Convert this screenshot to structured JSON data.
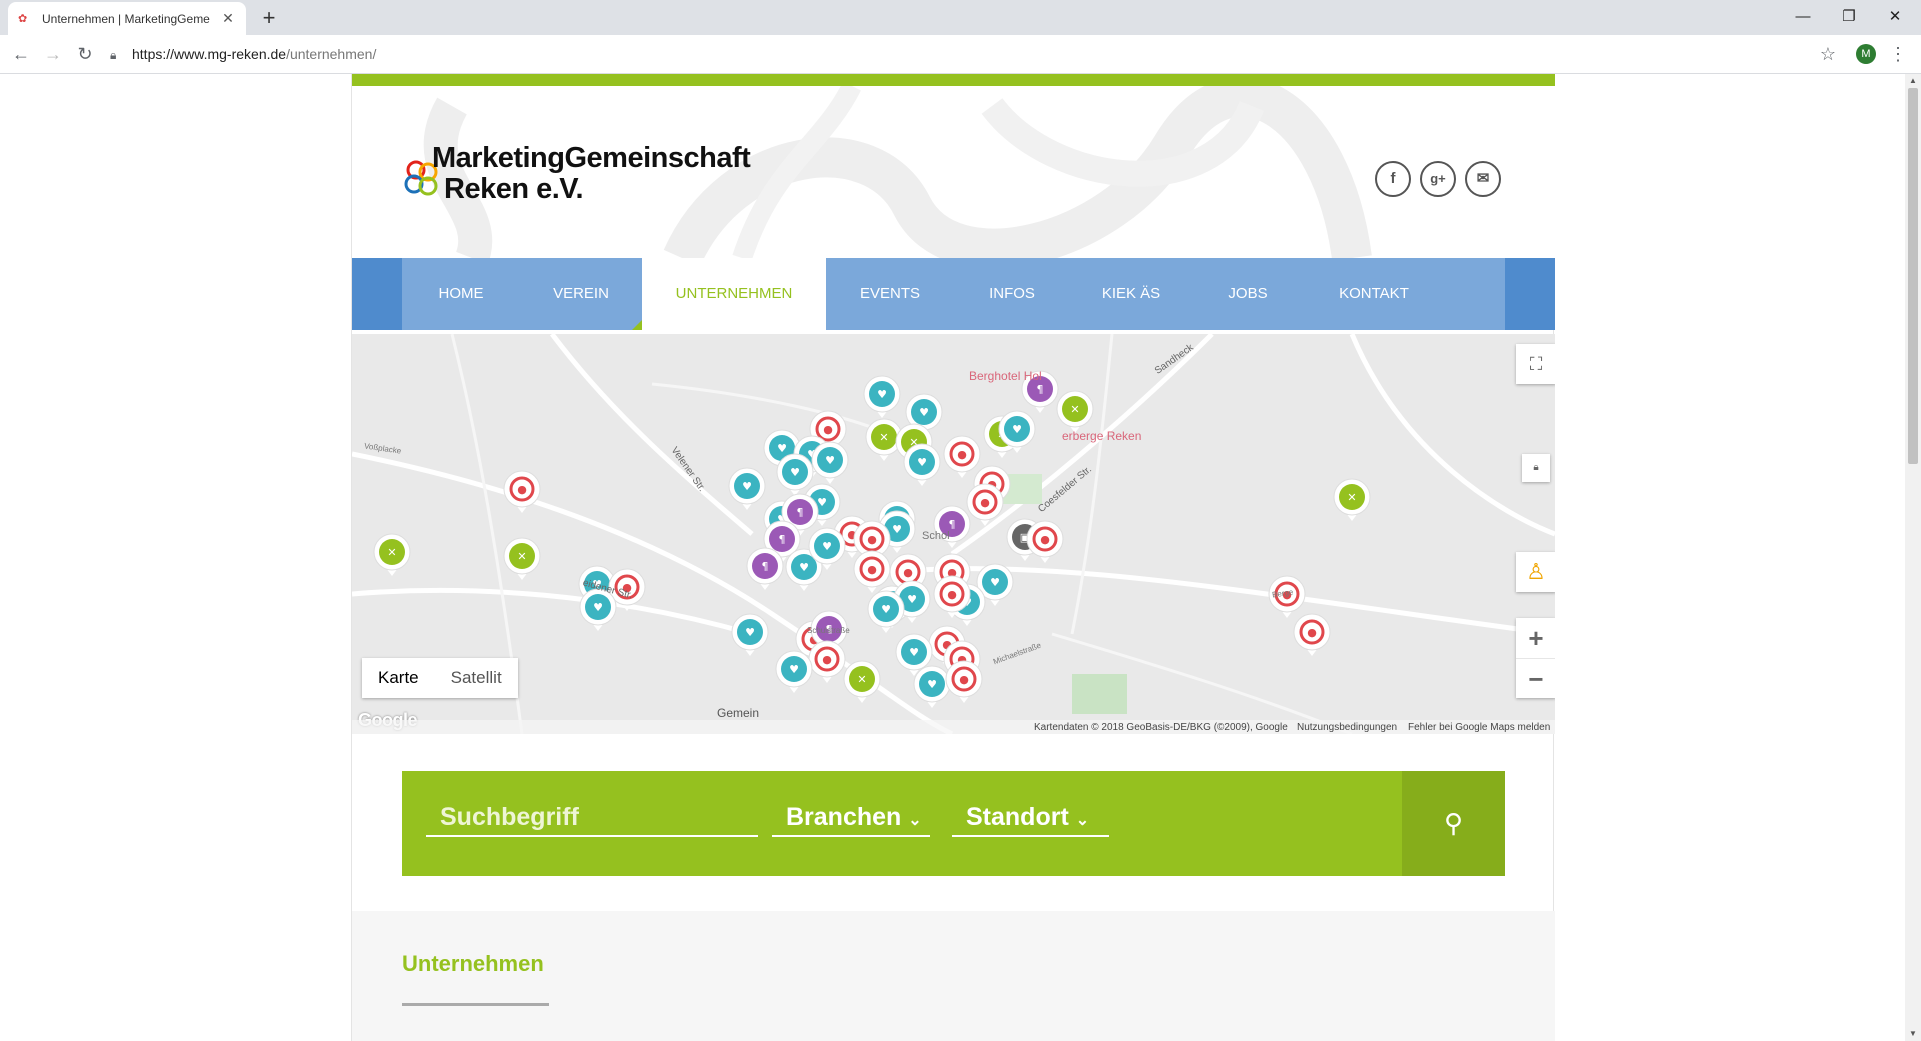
{
  "browser": {
    "tab_title": "Unternehmen | MarketingGeme",
    "tab_close": "✕",
    "new_tab": "+",
    "url_host": "https://www.mg-reken.de",
    "url_path": "/unternehmen/",
    "profile_initial": "M",
    "window_min": "—",
    "window_restore": "❐",
    "window_close": "✕"
  },
  "site": {
    "logo_line1": "MarketingGemeinschaft",
    "logo_line2": "Reken e.V.",
    "social": [
      "f",
      "g+",
      "✉"
    ],
    "nav": [
      "HOME",
      "VEREIN",
      "UNTERNEHMEN",
      "EVENTS",
      "INFOS",
      "KIEK ÄS",
      "JOBS",
      "KONTAKT"
    ],
    "active_nav": "UNTERNEHMEN",
    "accent_green": "#95c11f",
    "nav_blue": "#7ba8da"
  },
  "map": {
    "type_map": "Karte",
    "type_sat": "Satellit",
    "poi_hotel": "Berghotel Hol",
    "poi_herberge": "erberge Reken",
    "streets": [
      "Velener Str.",
      "Coesfelder Str.",
      "Sandheck",
      "Voßplacke",
      "Berge",
      "Schulstraße",
      "Michaelstraße",
      "Gemein",
      "Schol",
      "eidener Str."
    ],
    "attribution": "Kartendaten © 2018 GeoBasis-DE/BKG (©2009), Google",
    "terms": "Nutzungsbedingungen",
    "report": "Fehler bei Google Maps melden",
    "google": "Google",
    "zoom_in": "+",
    "zoom_out": "−"
  },
  "search": {
    "placeholder": "Suchbegriff",
    "branchen": "Branchen",
    "standort": "Standort"
  },
  "section": {
    "heading": "Unternehmen"
  }
}
